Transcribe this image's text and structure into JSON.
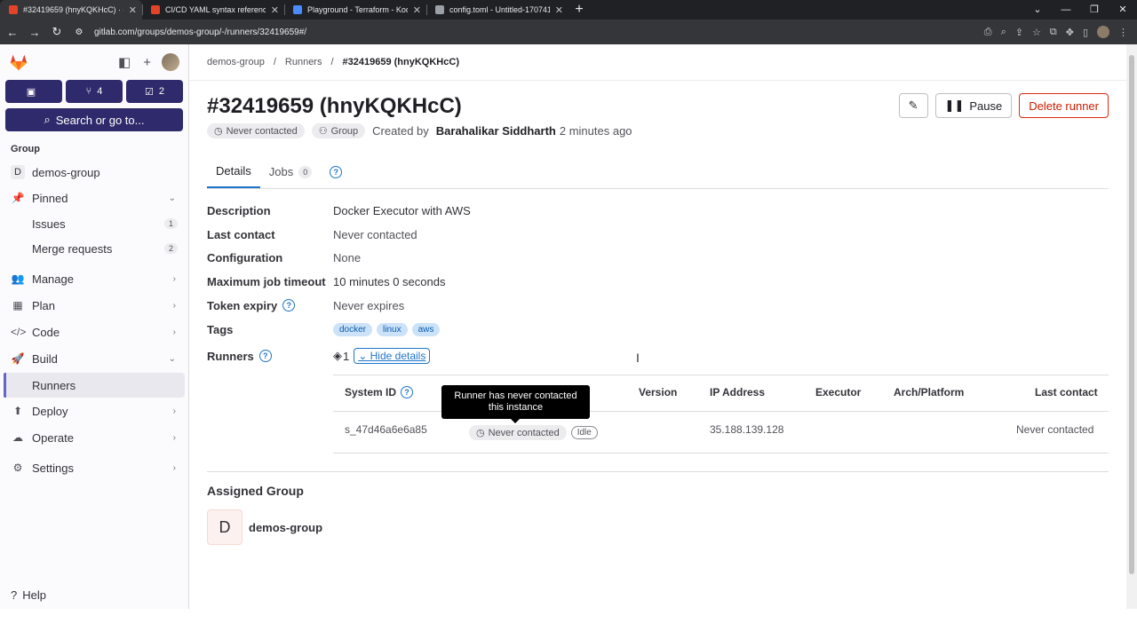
{
  "browser": {
    "tabs": [
      {
        "title": "#32419659 (hnyKQKHcC) · demos",
        "active": true,
        "color": "#e24329"
      },
      {
        "title": "CI/CD YAML syntax reference | G",
        "active": false,
        "color": "#e24329"
      },
      {
        "title": "Playground - Terraform - KodeK",
        "active": false,
        "color": "#4a8cff"
      },
      {
        "title": "config.toml - Untitled-17074123",
        "active": false,
        "color": "#9aa0a6"
      }
    ],
    "url": "gitlab.com/groups/demos-group/-/runners/32419659#/"
  },
  "sidebar": {
    "counts": [
      {
        "icon": "issues-icon",
        "value": ""
      },
      {
        "icon": "merge-request-icon",
        "value": "4"
      },
      {
        "icon": "todo-icon",
        "value": "2"
      }
    ],
    "search_label": "Search or go to...",
    "group_label": "Group",
    "group_item": {
      "letter": "D",
      "label": "demos-group"
    },
    "pinned": {
      "label": "Pinned",
      "items": [
        {
          "label": "Issues",
          "count": "1"
        },
        {
          "label": "Merge requests",
          "count": "2"
        }
      ]
    },
    "nav": [
      {
        "label": "Manage",
        "icon": "users-icon"
      },
      {
        "label": "Plan",
        "icon": "calendar-icon"
      },
      {
        "label": "Code",
        "icon": "code-icon"
      },
      {
        "label": "Build",
        "icon": "rocket-icon"
      },
      {
        "label": "Deploy",
        "icon": "deploy-icon"
      },
      {
        "label": "Operate",
        "icon": "cloud-icon"
      },
      {
        "label": "Settings",
        "icon": "gear-icon"
      }
    ],
    "active_item": "Runners",
    "help_label": "Help"
  },
  "breadcrumb": [
    "demos-group",
    "Runners",
    "#32419659 (hnyKQKHcC)"
  ],
  "page": {
    "title": "#32419659 (hnyKQKHcC)",
    "status_pill": "Never contacted",
    "type_pill": "Group",
    "created_by_prefix": "Created by",
    "created_by_user": "Barahalikar Siddharth",
    "created_time": "2 minutes ago",
    "pause_label": "Pause",
    "delete_label": "Delete runner"
  },
  "tabs": [
    {
      "label": "Details",
      "active": true
    },
    {
      "label": "Jobs",
      "count": "0"
    }
  ],
  "details": {
    "description": {
      "label": "Description",
      "value": "Docker Executor with AWS"
    },
    "last_contact": {
      "label": "Last contact",
      "value": "Never contacted"
    },
    "configuration": {
      "label": "Configuration",
      "value": "None"
    },
    "max_timeout": {
      "label": "Maximum job timeout",
      "value": "10 minutes 0 seconds"
    },
    "token_expiry": {
      "label": "Token expiry",
      "value": "Never expires"
    },
    "tags": {
      "label": "Tags",
      "values": [
        "docker",
        "linux",
        "aws"
      ]
    },
    "runners": {
      "label": "Runners",
      "count": "1",
      "hide_label": "Hide details"
    }
  },
  "runner_table": {
    "headers": [
      "System ID",
      "Version",
      "IP Address",
      "Executor",
      "Arch/Platform",
      "Last contact"
    ],
    "row": {
      "system_id": "s_47d46a6e6a85",
      "status": "Never contacted",
      "state": "Idle",
      "version": "",
      "ip": "35.188.139.128",
      "executor": "",
      "arch": "",
      "last_contact": "Never contacted"
    },
    "tooltip": "Runner has never contacted this instance"
  },
  "assigned": {
    "heading": "Assigned Group",
    "letter": "D",
    "name": "demos-group"
  }
}
